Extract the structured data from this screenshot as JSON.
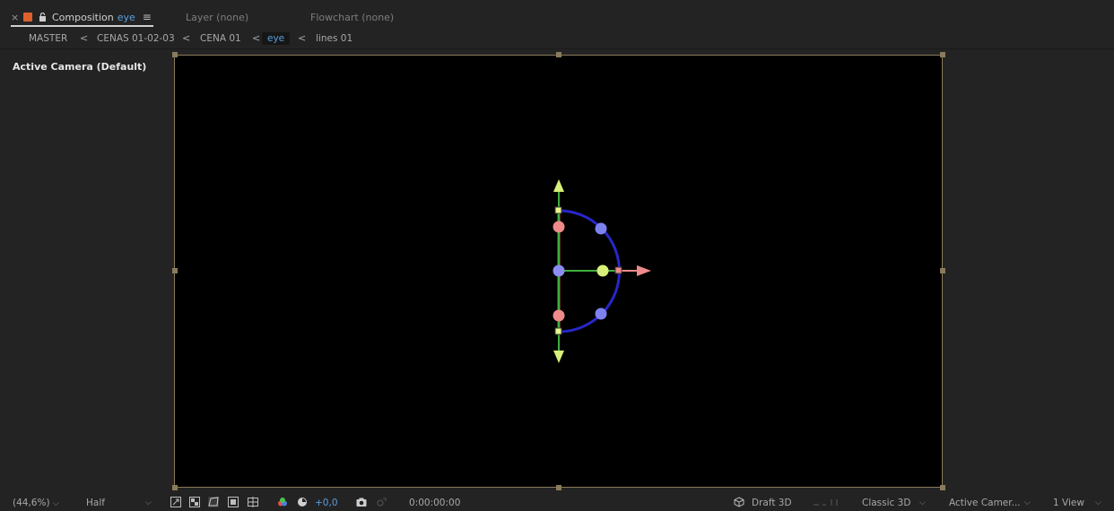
{
  "tabs": {
    "close_glyph": "×",
    "composition_prefix": "Composition",
    "composition_name": "eye",
    "menu_glyph": "≡",
    "layer": "Layer (none)",
    "flowchart": "Flowchart (none)"
  },
  "breadcrumb": {
    "items": [
      "MASTER",
      "CENAS 01-02-03",
      "CENA 01",
      "eye",
      "lines 01"
    ],
    "separator": "<"
  },
  "viewer": {
    "camera_label": "Active Camera (Default)"
  },
  "bottom": {
    "zoom": "(44,6%)",
    "resolution": "Half",
    "exposure": "+0,0",
    "timecode": "0:00:00:00",
    "renderer_draft": "Draft 3D",
    "renderer": "Classic 3D",
    "camera": "Active Camer...",
    "views": "1 View",
    "caret": "⌵"
  },
  "colors": {
    "accent": "#5a9fe0",
    "swatch": "#e0602c",
    "frame": "#8a7b5c"
  }
}
